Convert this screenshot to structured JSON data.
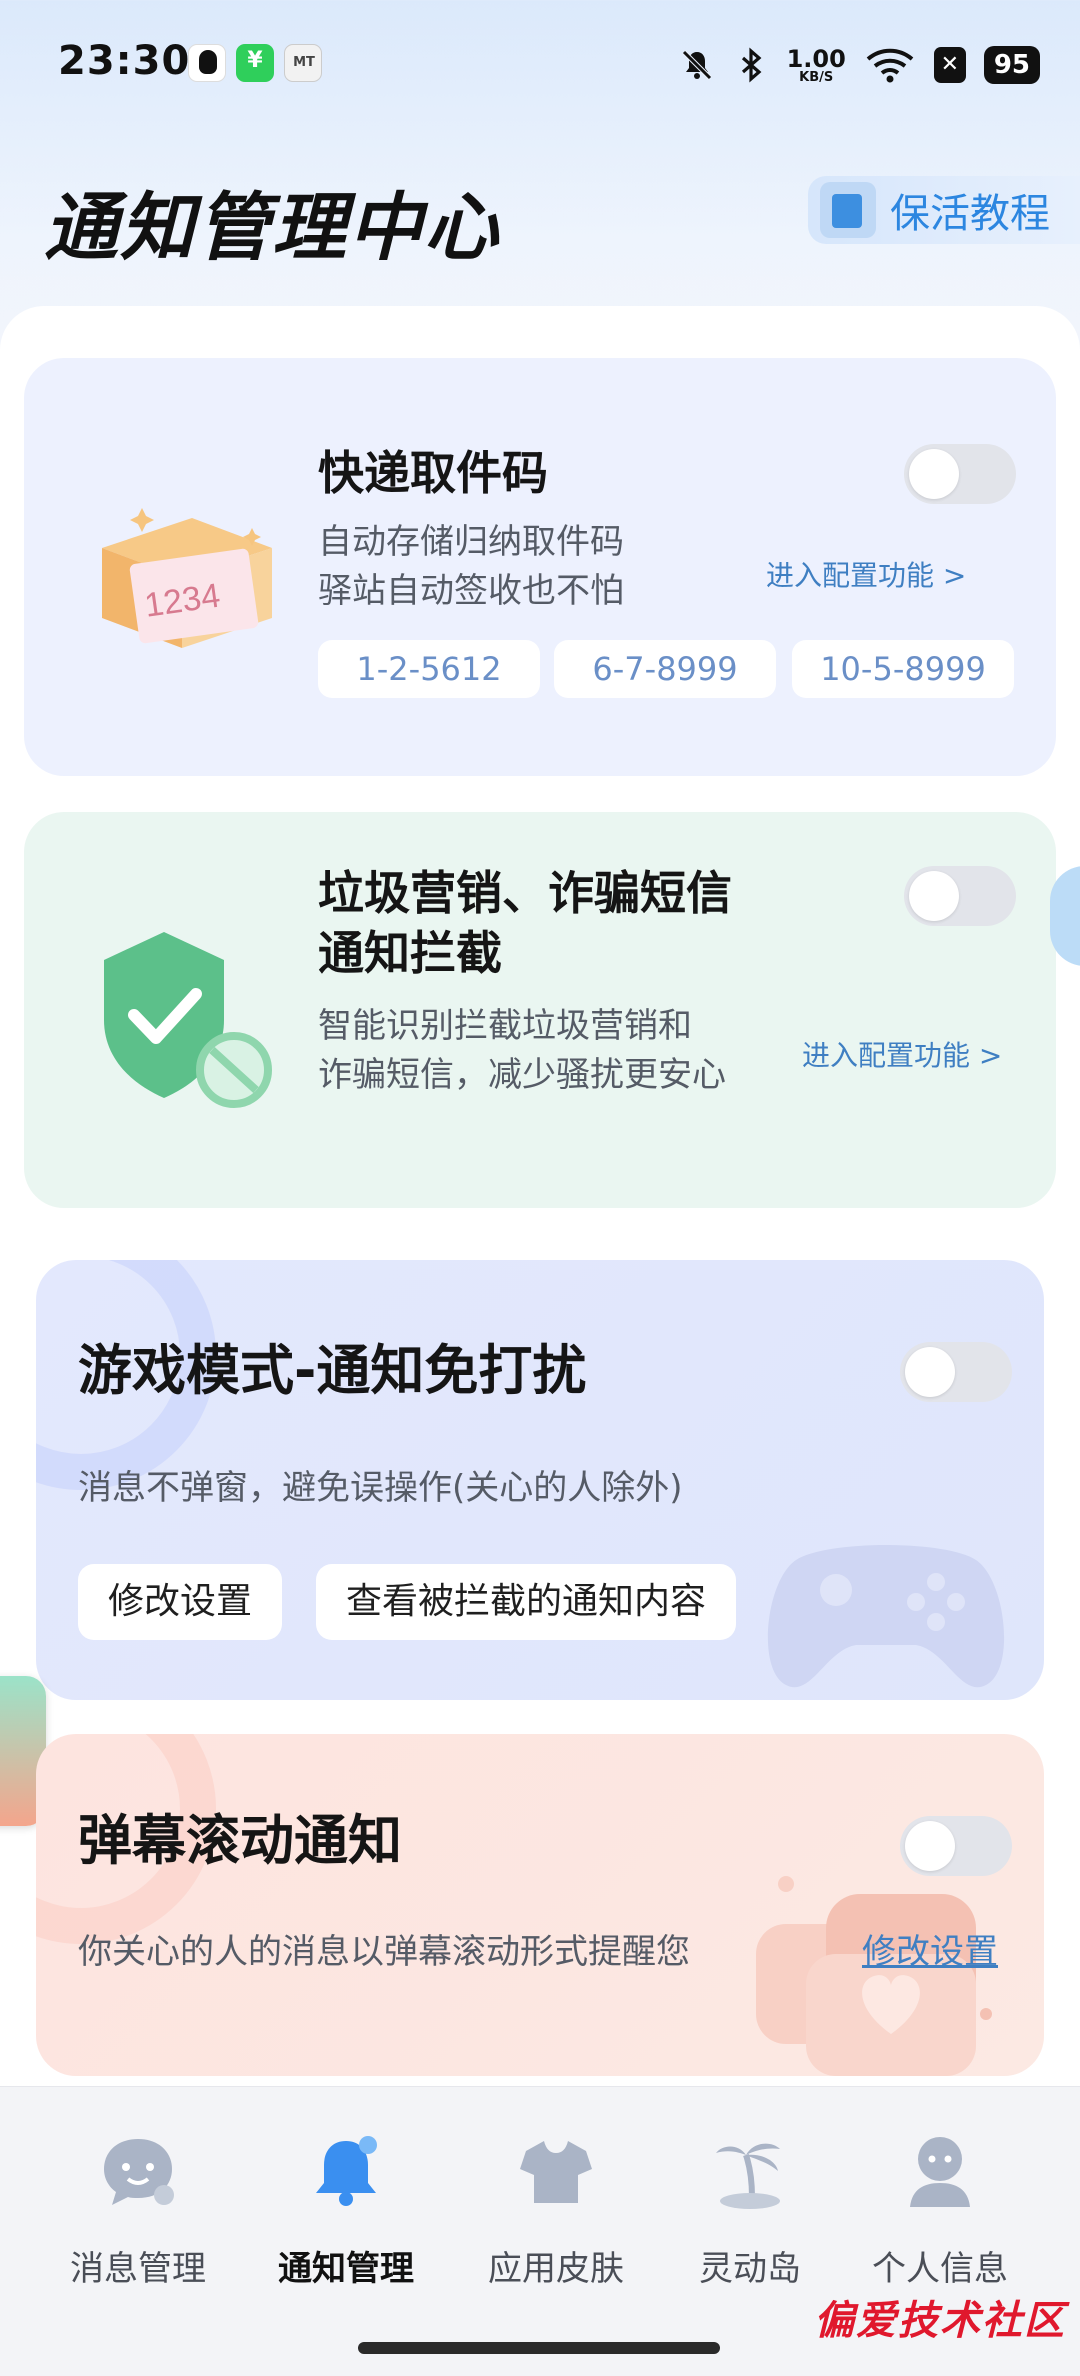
{
  "status_bar": {
    "time": "23:30",
    "net_speed_value": "1.00",
    "net_speed_unit": "KB/S",
    "battery": "95",
    "icons": [
      "qq-icon",
      "wechat-pay-icon",
      "mt-icon",
      "mute-icon",
      "bluetooth-icon",
      "wifi-icon",
      "x-icon"
    ]
  },
  "header": {
    "title": "通知管理中心",
    "keepalive_label": "保活教程"
  },
  "cards": {
    "express": {
      "title": "快递取件码",
      "desc_line1": "自动存储归纳取件码",
      "desc_line2": "驿站自动签收也不怕",
      "config_link": "进入配置功能 >",
      "codes": [
        "1-2-5612",
        "6-7-8999",
        "10-5-8999"
      ],
      "box_code": "1234"
    },
    "spam": {
      "title_line1": "垃圾营销、诈骗短信",
      "title_line2": "通知拦截",
      "desc_line1": "智能识别拦截垃圾营销和",
      "desc_line2": "诈骗短信，减少骚扰更安心",
      "config_link": "进入配置功能 >"
    },
    "game": {
      "title": "游戏模式-通知免打扰",
      "desc": "消息不弹窗，避免误操作(关心的人除外)",
      "btn_settings": "修改设置",
      "btn_view": "查看被拦截的通知内容"
    },
    "danmaku": {
      "title": "弹幕滚动通知",
      "desc": "你关心的人的消息以弹幕滚动形式提醒您",
      "link": "修改设置"
    }
  },
  "bottom_nav": {
    "items": [
      {
        "label": "消息管理",
        "icon": "chat-bubble-icon"
      },
      {
        "label": "通知管理",
        "icon": "bell-icon"
      },
      {
        "label": "应用皮肤",
        "icon": "tshirt-icon"
      },
      {
        "label": "灵动岛",
        "icon": "island-icon"
      },
      {
        "label": "个人信息",
        "icon": "person-icon"
      }
    ],
    "active_index": 1
  },
  "watermark": "偏爱技术社区",
  "colors": {
    "accent_blue": "#2c86e0",
    "link_blue": "#3f7fc2",
    "express_bg": "#edf1fe",
    "spam_bg": "#eaf6f1",
    "game_bg": "#e3e8fd",
    "danmaku_bg": "#fde4df"
  }
}
